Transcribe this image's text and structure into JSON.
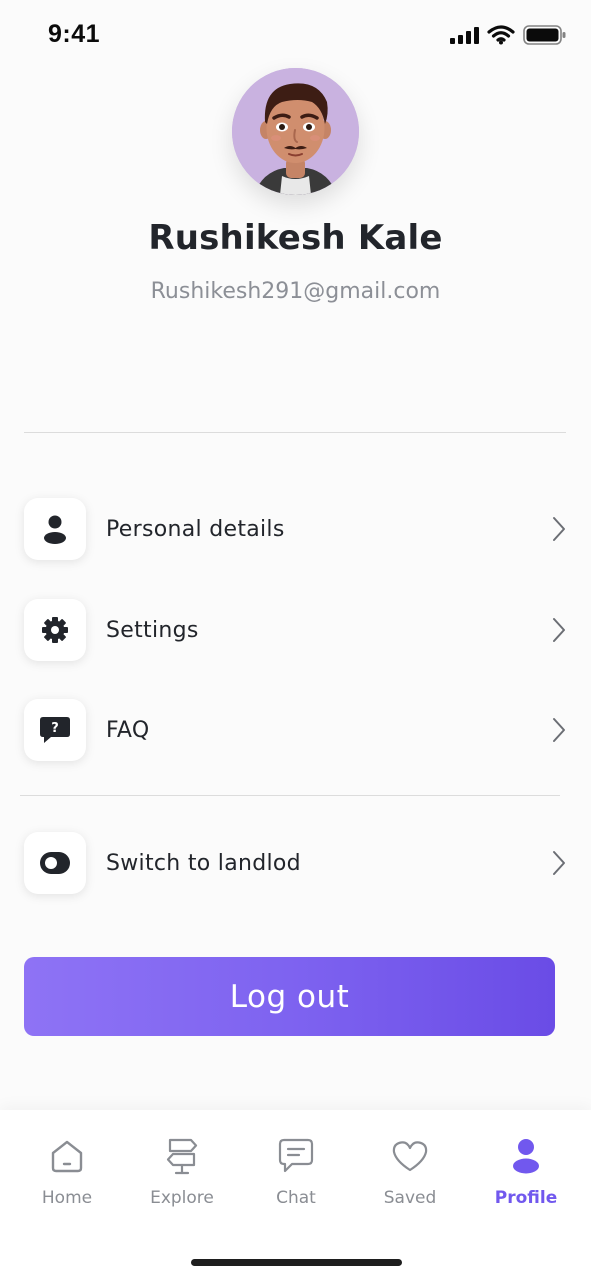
{
  "status_bar": {
    "time": "9:41"
  },
  "profile": {
    "name": "Rushikesh Kale",
    "email": "Rushikesh291@gmail.com"
  },
  "menu": {
    "items": [
      {
        "label": "Personal details",
        "icon": "user-icon"
      },
      {
        "label": "Settings",
        "icon": "gear-icon"
      },
      {
        "label": "FAQ",
        "icon": "question-chat-icon"
      },
      {
        "label": "Switch to landlod",
        "icon": "toggle-icon"
      }
    ]
  },
  "logout": {
    "label": "Log out"
  },
  "bottom_nav": {
    "items": [
      {
        "label": "Home",
        "icon": "home-icon"
      },
      {
        "label": "Explore",
        "icon": "signpost-icon"
      },
      {
        "label": "Chat",
        "icon": "chat-icon"
      },
      {
        "label": "Saved",
        "icon": "heart-icon"
      },
      {
        "label": "Profile",
        "icon": "profile-icon"
      }
    ],
    "active": "Profile"
  },
  "colors": {
    "accent": "#7158ee",
    "text_dark": "#22252b",
    "text_muted": "#8c8f96"
  }
}
